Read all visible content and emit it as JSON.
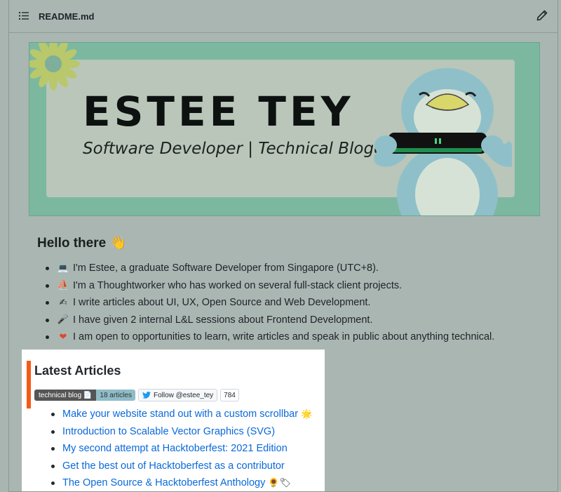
{
  "file": {
    "name": "README.md"
  },
  "banner": {
    "title": "ESTEE TEY",
    "subtitle": "Software Developer | Technical Blogger",
    "colors": {
      "outer": "#7cb8a0",
      "inner": "#b9c6b9"
    }
  },
  "intro": {
    "heading": "Hello there 👋",
    "items": [
      {
        "emoji": "💻",
        "text": "I'm Estee, a graduate Software Developer from Singapore (UTC+8)."
      },
      {
        "emoji": "⛵",
        "text": "I'm a Thoughtworker who has worked on several full-stack client projects."
      },
      {
        "emoji": "✍",
        "text": "I write articles about UI, UX, Open Source and Web Development."
      },
      {
        "emoji": "🎤",
        "text": "I have given 2 internal L&L sessions about Frontend Development."
      },
      {
        "emoji": "❤",
        "text": "I am open to opportunities to learn, write articles and speak in public about anything technical."
      }
    ]
  },
  "latest": {
    "heading": "Latest Articles",
    "badge_label": "technical blog 📄",
    "badge_value": "18 articles",
    "twitter_label": "Follow @estee_tey",
    "twitter_count": "784",
    "articles": [
      {
        "title": "Make your website stand out with a custom scrollbar",
        "emoji": "🌟"
      },
      {
        "title": "Introduction to Scalable Vector Graphics (SVG)",
        "emoji": ""
      },
      {
        "title": "My second attempt at Hacktoberfest: 2021 Edition",
        "emoji": ""
      },
      {
        "title": "Get the best out of Hacktoberfest as a contributor",
        "emoji": ""
      },
      {
        "title": "The Open Source & Hacktoberfest Anthology",
        "emoji": "🌻🏷"
      }
    ],
    "accent": "#f55a16",
    "link_color": "#0969da"
  }
}
